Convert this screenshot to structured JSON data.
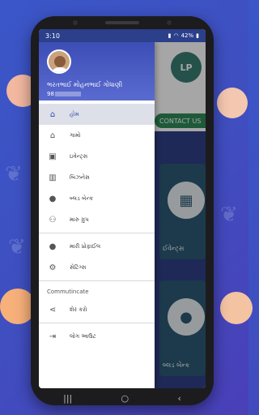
{
  "status_bar": {
    "time": "3:10",
    "battery": "42%"
  },
  "app_content": {
    "contact_label": "CONTACT US",
    "card1_label": "ઈવેન્ટ્સ",
    "card2_label": "બ્લડ બેન્ક"
  },
  "drawer": {
    "user_name": "ભરતભાઈ મોહનભાઈ ગોધાણી",
    "user_phone_prefix": "98",
    "menu": [
      {
        "label": "હોમ",
        "icon": "home-icon",
        "active": true
      },
      {
        "label": "ગામો",
        "icon": "village-icon",
        "active": false
      },
      {
        "label": "ઇવેન્ટ્સ",
        "icon": "event-icon",
        "active": false
      },
      {
        "label": "બિઝનેસ",
        "icon": "business-icon",
        "active": false
      },
      {
        "label": "બ્લડ બેન્ક",
        "icon": "blood-drop-icon",
        "active": false
      },
      {
        "label": "મારુ ગ્રુપ",
        "icon": "group-icon",
        "active": false
      }
    ],
    "menu2": [
      {
        "label": "મારી પ્રોફાઈલ",
        "icon": "person-icon"
      },
      {
        "label": "સેટિંગ્સ",
        "icon": "gear-icon"
      }
    ],
    "section_title": "Commutincate",
    "share_label": "શેર કરો",
    "logout_label": "લોગ આઉટ"
  },
  "colors": {
    "header_blue": "#3c4eb6",
    "active_bg": "#dde0e8",
    "active_text": "#3344aa"
  }
}
